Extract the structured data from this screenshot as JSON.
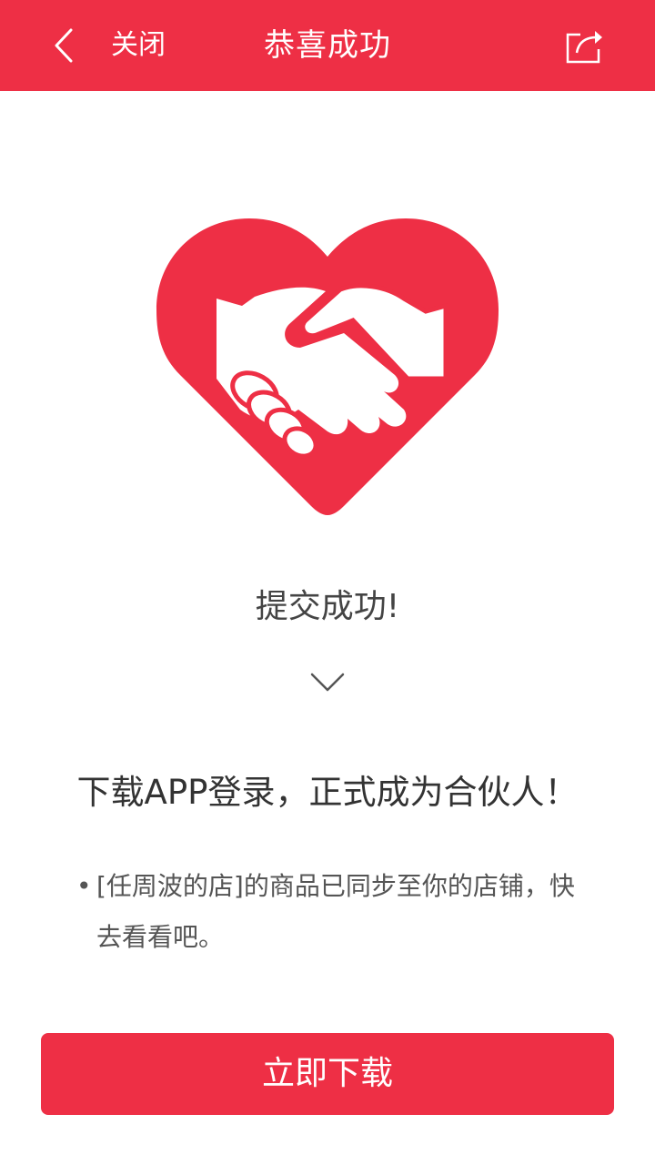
{
  "header": {
    "back_icon": "chevron-left-icon",
    "close_label": "关闭",
    "title": "恭喜成功",
    "share_icon": "share-icon",
    "background_color": "#ee2f45"
  },
  "illustration": {
    "icon": "heart-handshake-icon",
    "color": "#ee2f45"
  },
  "status": {
    "text": "提交成功!",
    "chevron_icon": "chevron-down-icon"
  },
  "main": {
    "headline": "下载APP登录，正式成为合伙人！",
    "notice": "[任周波的店]的商品已同步至你的店铺，快去看看吧。",
    "bullet": "•"
  },
  "footer": {
    "download_label": "立即下载",
    "button_color": "#ee2f45"
  }
}
